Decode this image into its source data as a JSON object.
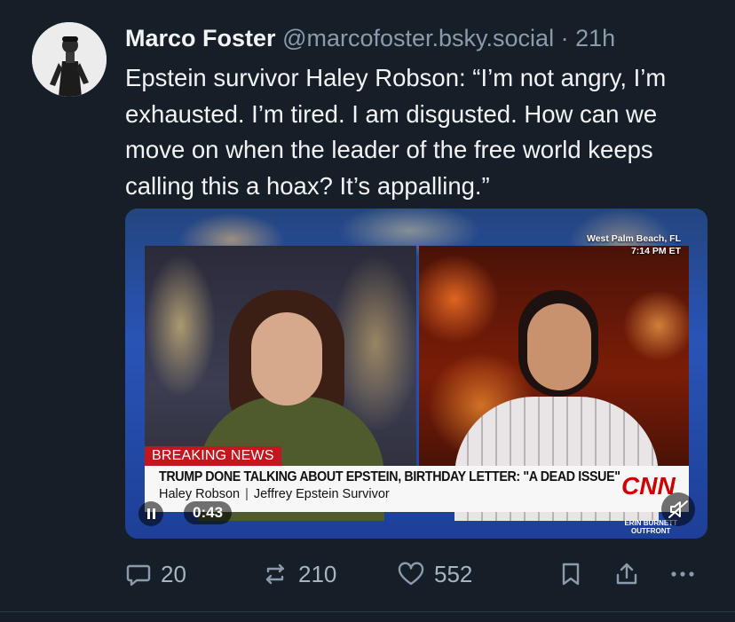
{
  "post": {
    "author_name": "Marco Foster",
    "handle": "@marcofoster.bsky.social",
    "separator": "·",
    "time": "21h",
    "text": "Epstein survivor Haley Robson: “I’m not angry, I’m exhausted. I’m tired. I am disgusted. How can we move on when the leader of the free world keeps calling this a hoax? It’s appalling.”"
  },
  "video": {
    "location": "West Palm Beach, FL",
    "clock": "7:14 PM ET",
    "breaking_label": "BREAKING NEWS",
    "headline": "TRUMP DONE TALKING ABOUT EPSTEIN, BIRTHDAY LETTER: \"A DEAD ISSUE\"",
    "guest_name": "Haley Robson",
    "guest_title": "Jeffrey Epstein Survivor",
    "network_logo": "CNN",
    "program_line1": "ERIN BURNETT",
    "program_line2": "OUTFRONT",
    "timecode": "0:43",
    "playback_state": "playing",
    "muted": true
  },
  "actions": {
    "replies": "20",
    "reposts": "210",
    "likes": "552"
  },
  "icons": {
    "reply": "reply-icon",
    "repost": "repost-icon",
    "like": "heart-icon",
    "bookmark": "bookmark-icon",
    "share": "share-icon",
    "more": "more-icon",
    "pause": "pause-icon",
    "mute": "mute-icon"
  },
  "colors": {
    "background": "#161e27",
    "muted_text": "#8c9bab",
    "breaking_red": "#c4161c"
  }
}
